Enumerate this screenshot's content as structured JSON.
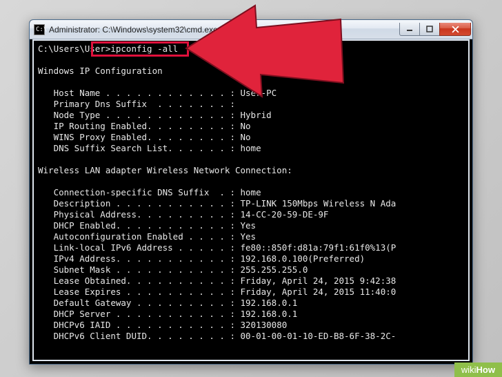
{
  "window": {
    "icon_text": "C:\\",
    "title": "Administrator: C:\\Windows\\system32\\cmd.exe"
  },
  "terminal": {
    "prompt": "C:\\Users\\User>",
    "command": "ipconfig -all",
    "sections": {
      "header": "Windows IP Configuration",
      "host": {
        "host_name_label": "   Host Name . . . . . . . . . . . . :",
        "host_name_value": " User-PC",
        "primary_dns_label": "   Primary Dns Suffix  . . . . . . . :",
        "primary_dns_value": "",
        "node_type_label": "   Node Type . . . . . . . . . . . . :",
        "node_type_value": " Hybrid",
        "ip_routing_label": "   IP Routing Enabled. . . . . . . . :",
        "ip_routing_value": " No",
        "wins_proxy_label": "   WINS Proxy Enabled. . . . . . . . :",
        "wins_proxy_value": " No",
        "dns_suffix_list_label": "   DNS Suffix Search List. . . . . . :",
        "dns_suffix_list_value": " home"
      },
      "adapter_header": "Wireless LAN adapter Wireless Network Connection:",
      "adapter": {
        "conn_dns_label": "   Connection-specific DNS Suffix  . :",
        "conn_dns_value": " home",
        "desc_label": "   Description . . . . . . . . . . . :",
        "desc_value": " TP-LINK 150Mbps Wireless N Ada",
        "phys_label": "   Physical Address. . . . . . . . . :",
        "phys_value": " 14-CC-20-59-DE-9F",
        "dhcp_en_label": "   DHCP Enabled. . . . . . . . . . . :",
        "dhcp_en_value": " Yes",
        "autoconf_label": "   Autoconfiguration Enabled . . . . :",
        "autoconf_value": " Yes",
        "linklocal_label": "   Link-local IPv6 Address . . . . . :",
        "linklocal_value": " fe80::850f:d81a:79f1:61f0%13(P",
        "ipv4_label": "   IPv4 Address. . . . . . . . . . . :",
        "ipv4_value": " 192.168.0.100(Preferred)",
        "subnet_label": "   Subnet Mask . . . . . . . . . . . :",
        "subnet_value": " 255.255.255.0",
        "lease_obt_label": "   Lease Obtained. . . . . . . . . . :",
        "lease_obt_value": " Friday, April 24, 2015 9:42:38",
        "lease_exp_label": "   Lease Expires . . . . . . . . . . :",
        "lease_exp_value": " Friday, April 24, 2015 11:40:0",
        "gateway_label": "   Default Gateway . . . . . . . . . :",
        "gateway_value": " 192.168.0.1",
        "dhcp_srv_label": "   DHCP Server . . . . . . . . . . . :",
        "dhcp_srv_value": " 192.168.0.1",
        "iaid_label": "   DHCPv6 IAID . . . . . . . . . . . :",
        "iaid_value": " 320130080",
        "duid_label": "   DHCPv6 Client DUID. . . . . . . . :",
        "duid_value": " 00-01-00-01-10-ED-B8-6F-38-2C-"
      }
    }
  },
  "watermark": {
    "prefix": "wiki",
    "suffix": "How"
  }
}
